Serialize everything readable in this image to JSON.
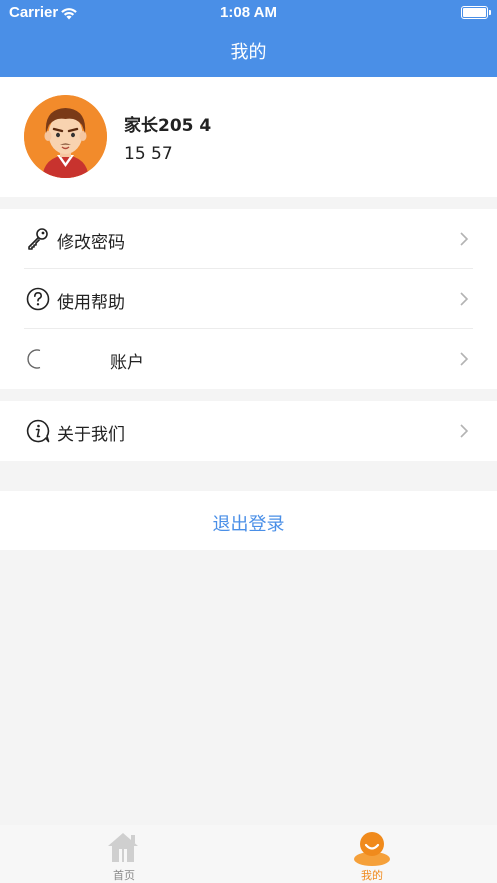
{
  "status_bar": {
    "carrier": "Carrier",
    "time": "1:08 AM"
  },
  "nav": {
    "title": "我的"
  },
  "profile": {
    "name": "家长205   4",
    "phone": "15          57"
  },
  "menu_group_1": [
    {
      "label": "修改密码",
      "icon": "key-icon"
    },
    {
      "label": "使用帮助",
      "icon": "question-circle-icon"
    },
    {
      "label": "账户",
      "icon": "account-icon"
    }
  ],
  "menu_group_2": [
    {
      "label": "关于我们",
      "icon": "info-bubble-icon"
    }
  ],
  "logout": {
    "label": "退出登录"
  },
  "tabs": [
    {
      "label": "首页",
      "icon": "home-icon",
      "active": false
    },
    {
      "label": "我的",
      "icon": "profile-icon",
      "active": true
    }
  ],
  "colors": {
    "primary": "#4a8fe7",
    "tab_active": "#f08a1c",
    "tab_inactive": "#8a8a8a",
    "avatar_bg": "#f28b2b"
  }
}
